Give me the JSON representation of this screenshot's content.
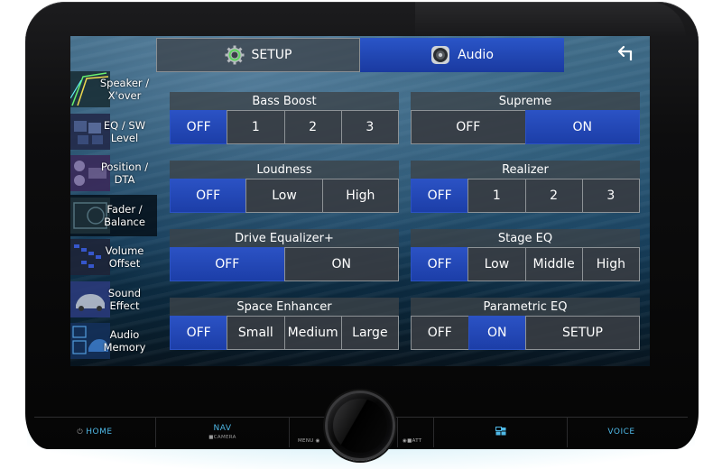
{
  "header": {
    "tabs": [
      {
        "label": "SETUP",
        "icon": "gear-icon",
        "active": false
      },
      {
        "label": "Audio",
        "icon": "speaker-icon",
        "active": true
      }
    ],
    "back_icon": "back-arrow-icon"
  },
  "sidebar": {
    "items": [
      {
        "line1": "Speaker /",
        "line2": "X'over",
        "selected": false
      },
      {
        "line1": "EQ / SW",
        "line2": "Level",
        "selected": false
      },
      {
        "line1": "Position /",
        "line2": "DTA",
        "selected": false
      },
      {
        "line1": "Fader /",
        "line2": "Balance",
        "selected": true
      },
      {
        "line1": "Volume",
        "line2": "Offset",
        "selected": false
      },
      {
        "line1": "Sound",
        "line2": "Effect",
        "selected": false
      },
      {
        "line1": "Audio",
        "line2": "Memory",
        "selected": false
      }
    ]
  },
  "panels": {
    "bass_boost": {
      "title": "Bass Boost",
      "options": [
        "OFF",
        "1",
        "2",
        "3"
      ],
      "selected": "OFF"
    },
    "supreme": {
      "title": "Supreme",
      "options": [
        "OFF",
        "ON"
      ],
      "selected": "ON"
    },
    "loudness": {
      "title": "Loudness",
      "options": [
        "OFF",
        "Low",
        "High"
      ],
      "selected": "OFF"
    },
    "realizer": {
      "title": "Realizer",
      "options": [
        "OFF",
        "1",
        "2",
        "3"
      ],
      "selected": "OFF"
    },
    "drive_eq": {
      "title": "Drive Equalizer+",
      "options": [
        "OFF",
        "ON"
      ],
      "selected": "OFF"
    },
    "stage_eq": {
      "title": "Stage EQ",
      "options": [
        "OFF",
        "Low",
        "Middle",
        "High"
      ],
      "selected": "OFF"
    },
    "space_enhancer": {
      "title": "Space Enhancer",
      "options": [
        "OFF",
        "Small",
        "Medium",
        "Large"
      ],
      "selected": "OFF"
    },
    "parametric_eq": {
      "title": "Parametric EQ",
      "options": [
        "OFF",
        "ON",
        "SETUP"
      ],
      "selected": "ON"
    }
  },
  "hardware": {
    "home": "HOME",
    "nav": "NAV",
    "nav_sub": "CAMERA",
    "menu": "MENU",
    "att": "ATT",
    "voice": "VOICE",
    "accent": "#4fb8e6"
  },
  "colors": {
    "active_button": "#2b52c4",
    "inactive_button": "#373c42"
  }
}
